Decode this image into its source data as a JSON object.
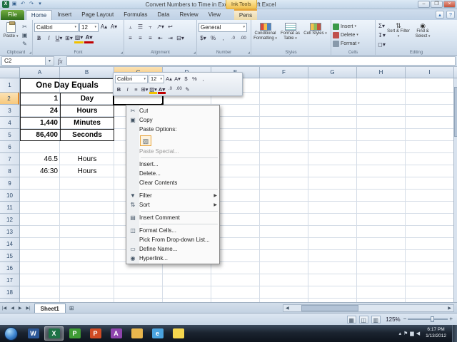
{
  "titlebar": {
    "title": "Convert Numbers to Time in Excel - Microsoft Excel",
    "contextual_group": "Ink Tools"
  },
  "tabs": [
    "File",
    "Home",
    "Insert",
    "Page Layout",
    "Formulas",
    "Data",
    "Review",
    "View",
    "Pens"
  ],
  "active_tab": "Home",
  "ribbon": {
    "paste": "Paste",
    "font_name": "Calibri",
    "font_size": "12",
    "number_format": "General",
    "conditional_formatting": "Conditional Formatting",
    "format_as_table": "Format as Table",
    "cell_styles": "Cell Styles",
    "insert": "Insert",
    "delete": "Delete",
    "format": "Format",
    "sort_filter": "Sort & Filter",
    "find_select": "Find & Select",
    "groups": {
      "clipboard": "Clipboard",
      "font": "Font",
      "alignment": "Alignment",
      "number": "Number",
      "styles": "Styles",
      "cells": "Cells",
      "editing": "Editing"
    }
  },
  "formula_bar": {
    "name_box": "C2",
    "fx": "fx",
    "formula": ""
  },
  "grid": {
    "columns": [
      {
        "label": "A",
        "w": 56
      },
      {
        "label": "B",
        "w": 76
      },
      {
        "label": "C",
        "w": 68
      },
      {
        "label": "D",
        "w": 68
      },
      {
        "label": "E",
        "w": 68
      },
      {
        "label": "F",
        "w": 68
      },
      {
        "label": "G",
        "w": 68
      },
      {
        "label": "H",
        "w": 68
      },
      {
        "label": "I",
        "w": 68
      }
    ],
    "row_count": 18,
    "selected_cell": "C2",
    "selected_col": "C",
    "selected_row": 2,
    "merged_title": "One Day Equals",
    "cells": [
      {
        "ref": "A2",
        "v": "1",
        "align": "right"
      },
      {
        "ref": "B2",
        "v": "Day",
        "align": "center"
      },
      {
        "ref": "A3",
        "v": "24",
        "align": "right"
      },
      {
        "ref": "B3",
        "v": "Hours",
        "align": "center"
      },
      {
        "ref": "A4",
        "v": "1,440",
        "align": "right"
      },
      {
        "ref": "B4",
        "v": "Minutes",
        "align": "center"
      },
      {
        "ref": "A5",
        "v": "86,400",
        "align": "right"
      },
      {
        "ref": "B5",
        "v": "Seconds",
        "align": "center"
      },
      {
        "ref": "A7",
        "v": "46.5",
        "align": "right"
      },
      {
        "ref": "B7",
        "v": "Hours",
        "align": "center"
      },
      {
        "ref": "A8",
        "v": "46:30",
        "align": "right"
      },
      {
        "ref": "B8",
        "v": "Hours",
        "align": "center"
      }
    ]
  },
  "mini_toolbar": {
    "font_name": "Calibri",
    "font_size": "12"
  },
  "context_menu": {
    "items": [
      {
        "label": "Cut",
        "icon": "scissors-icon"
      },
      {
        "label": "Copy",
        "icon": "copy-icon"
      },
      {
        "label": "Paste Options:"
      },
      {
        "type": "paste-row",
        "icon": "paste-icon"
      },
      {
        "label": "Paste Special...",
        "disabled": true
      },
      {
        "type": "sep"
      },
      {
        "label": "Insert..."
      },
      {
        "label": "Delete..."
      },
      {
        "label": "Clear Contents"
      },
      {
        "type": "sep"
      },
      {
        "label": "Filter",
        "submenu": true,
        "icon": "filter-icon"
      },
      {
        "label": "Sort",
        "submenu": true,
        "icon": "sort-icon"
      },
      {
        "type": "sep"
      },
      {
        "label": "Insert Comment",
        "icon": "comment-icon"
      },
      {
        "type": "sep"
      },
      {
        "label": "Format Cells...",
        "icon": "format-cells-icon"
      },
      {
        "label": "Pick From Drop-down List..."
      },
      {
        "label": "Define Name...",
        "icon": "define-name-icon"
      },
      {
        "label": "Hyperlink...",
        "icon": "hyperlink-icon"
      }
    ]
  },
  "sheet_bar": {
    "tabs": [
      {
        "label": "Sheet1",
        "active": true
      }
    ]
  },
  "status_bar": {
    "zoom": "125%"
  },
  "taskbar": {
    "time": "6:17 PM",
    "date": "1/13/2012",
    "items": [
      {
        "name": "word",
        "label": "W",
        "color": "#2b5797"
      },
      {
        "name": "excel",
        "label": "X",
        "color": "#1e7145",
        "active": true
      },
      {
        "name": "publisher",
        "label": "P",
        "color": "#3f9c35"
      },
      {
        "name": "powerpoint",
        "label": "P",
        "color": "#d04b24"
      },
      {
        "name": "access",
        "label": "A",
        "color": "#8e44ad"
      },
      {
        "name": "folder",
        "label": "",
        "color": "#e9b64d"
      },
      {
        "name": "browser",
        "label": "e",
        "color": "#4aa3df"
      },
      {
        "name": "notes",
        "label": "",
        "color": "#f5d64e"
      }
    ]
  }
}
